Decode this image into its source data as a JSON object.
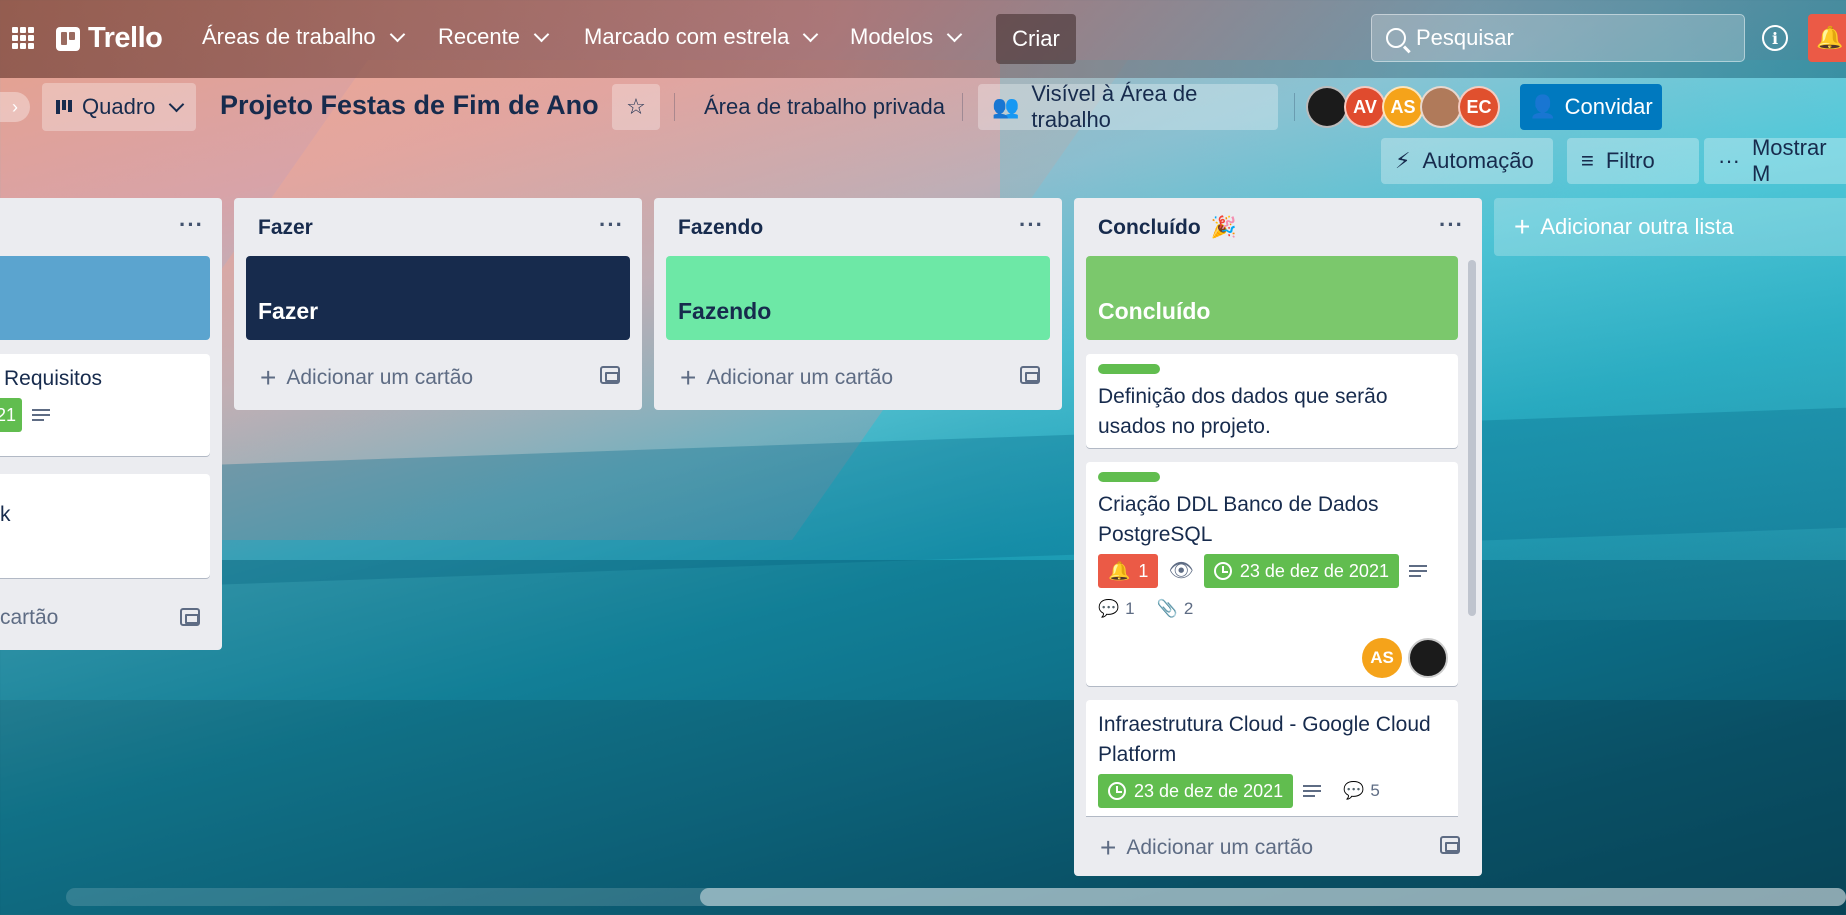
{
  "nav": {
    "logo_text": "Trello",
    "menus": [
      "Áreas de trabalho",
      "Recente",
      "Marcado com estrela",
      "Modelos"
    ],
    "create_label": "Criar",
    "search_placeholder": "Pesquisar",
    "info_glyph": "i"
  },
  "board": {
    "view_label": "Quadro",
    "title": "Projeto Festas de Fim de Ano",
    "workspace_label": "Área de trabalho privada",
    "visibility_label": "Visível à Área de trabalho",
    "invite_label": "Convidar",
    "automation_label": "Automação",
    "filter_label": "Filtro",
    "show_menu_label": "Mostrar M",
    "members": [
      {
        "initials": "",
        "color": "#1b1b1b"
      },
      {
        "initials": "AV",
        "color": "#e04b2e"
      },
      {
        "initials": "AS",
        "color": "#f5a31a"
      },
      {
        "initials": "",
        "color": "#b07a5a"
      },
      {
        "initials": "EC",
        "color": "#e0502e"
      }
    ]
  },
  "lists": {
    "partial": {
      "card1_text": "Requisitos",
      "card1_badge": "21",
      "card2_text": "k",
      "add_card": "cartão",
      "cover_color": "#5ba4cf"
    },
    "fazer": {
      "title": "Fazer",
      "cover_text": "Fazer",
      "cover_color": "#172b4d",
      "add_card": "Adicionar um cartão"
    },
    "fazendo": {
      "title": "Fazendo",
      "cover_text": "Fazendo",
      "cover_color": "#6de8a6",
      "add_card": "Adicionar um cartão"
    },
    "concluido": {
      "title": "Concluído",
      "title_icon": "🎉",
      "cover_text": "Concluído",
      "cover_color": "#7bc86c",
      "add_card": "Adicionar um cartão",
      "cards": [
        {
          "text": "Definição dos dados que serão usados no projeto."
        },
        {
          "text": "Criação DDL Banco de Dados PostgreSQL",
          "notification": "1",
          "due": "23 de dez de 2021",
          "comments": "1",
          "attachments": "2",
          "member_initials": "AS"
        },
        {
          "text": "Infraestrutura Cloud - Google Cloud Platform",
          "due": "23 de dez de 2021",
          "comments": "5"
        }
      ]
    }
  },
  "add_list_label": "Adicionar outra lista",
  "colors": {
    "label_green": "#61bd4f",
    "notification_red": "#eb5a46",
    "invite_blue": "#0079bf",
    "due_green": "#61bd4f"
  }
}
